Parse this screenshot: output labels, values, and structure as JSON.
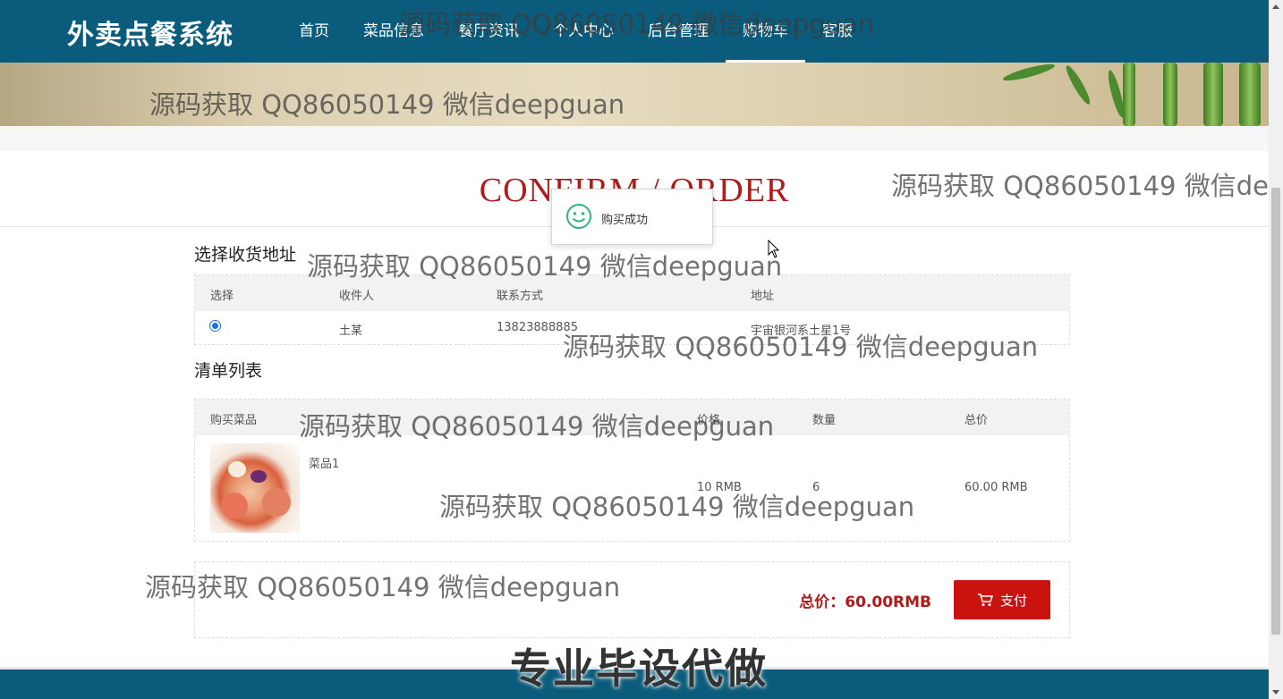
{
  "header": {
    "brand": "外卖点餐系统",
    "nav": [
      {
        "label": "首页"
      },
      {
        "label": "菜品信息"
      },
      {
        "label": "餐厅资讯"
      },
      {
        "label": "个人中心"
      },
      {
        "label": "后台管理"
      },
      {
        "label": "购物车",
        "active": true
      },
      {
        "label": "客服"
      }
    ]
  },
  "page_title": "CONFIRM / ORDER",
  "address_section": {
    "title": "选择收货地址",
    "columns": [
      "选择",
      "收件人",
      "联系方式",
      "地址"
    ],
    "rows": [
      {
        "selected": true,
        "recipient": "土某",
        "phone": "13823888885",
        "address": "宇宙银河系土星1号"
      }
    ]
  },
  "order_section": {
    "title": "清单列表",
    "columns": [
      "购买菜品",
      "价格",
      "数量",
      "总价"
    ],
    "items": [
      {
        "name": "菜品1",
        "price": "10 RMB",
        "quantity": "6",
        "total": "60.00 RMB"
      }
    ]
  },
  "summary": {
    "total_label": "总价：60.00RMB",
    "pay_button": "支付"
  },
  "toast": {
    "message": "购买成功",
    "icon": "smile-icon"
  },
  "watermark": {
    "text": "源码获取 QQ86050149 微信deepguan",
    "bottom_text": "专业毕设代做"
  },
  "colors": {
    "header_bg": "#0b5c7c",
    "accent_red": "#c9130f",
    "title_red": "#b01a1a"
  }
}
